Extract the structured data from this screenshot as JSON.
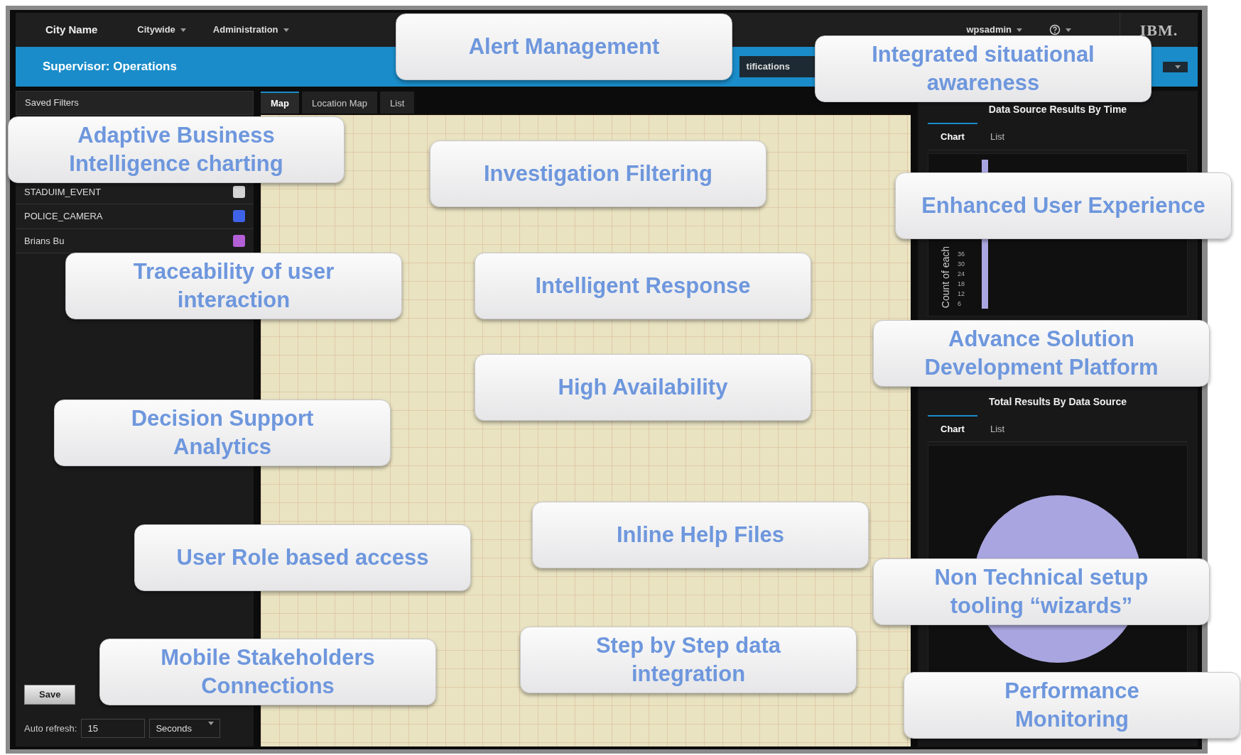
{
  "topbar": {
    "brand": "City Name",
    "menus": [
      {
        "label": "Citywide"
      },
      {
        "label": "Administration"
      }
    ],
    "user": "wpsadmin",
    "logo": "IBM."
  },
  "header": {
    "title": "Supervisor: Operations",
    "dropdown": "tifications"
  },
  "sidebar": {
    "title": "Saved Filters",
    "filters": [
      {
        "label": "STADUIM_EVENT",
        "color": "#d4d4d4"
      },
      {
        "label": "POLICE_CAMERA",
        "color": "#3f63e8"
      },
      {
        "label": "Brians Bu",
        "color": "#b35fd6"
      }
    ],
    "buttons": [
      "Save"
    ],
    "auto_refresh": {
      "label": "Auto refresh:",
      "value": "15",
      "unit": "Seconds"
    }
  },
  "map_tabs": [
    {
      "label": "Map",
      "selected": true
    },
    {
      "label": "Location Map",
      "selected": false
    },
    {
      "label": "List",
      "selected": false
    }
  ],
  "panels": [
    {
      "kind": "bar",
      "title": "Data Source Results By Time",
      "tabs": [
        {
          "label": "Chart",
          "selected": true
        },
        {
          "label": "List",
          "selected": false
        }
      ],
      "ylabel": "Count of each",
      "ticks": [
        "36",
        "30",
        "24",
        "18",
        "12",
        "6"
      ]
    },
    {
      "kind": "pie",
      "title": "Total Results By Data Source",
      "tabs": [
        {
          "label": "Chart",
          "selected": true
        },
        {
          "label": "List",
          "selected": false
        }
      ]
    }
  ],
  "callouts": [
    "Alert Management",
    "Integrated situational\nawareness",
    "Adaptive Business\nIntelligence charting",
    "Investigation Filtering",
    "Enhanced User Experience",
    "Traceability of user\ninteraction",
    "Intelligent Response",
    "Advance Solution\nDevelopment Platform",
    "High Availability",
    "Decision Support\nAnalytics",
    "Inline Help Files",
    "User Role based access",
    "Non Technical setup\ntooling “wizards”",
    "Mobile Stakeholders\nConnections",
    "Step by Step data\nintegration",
    "Performance\nMonitoring"
  ]
}
